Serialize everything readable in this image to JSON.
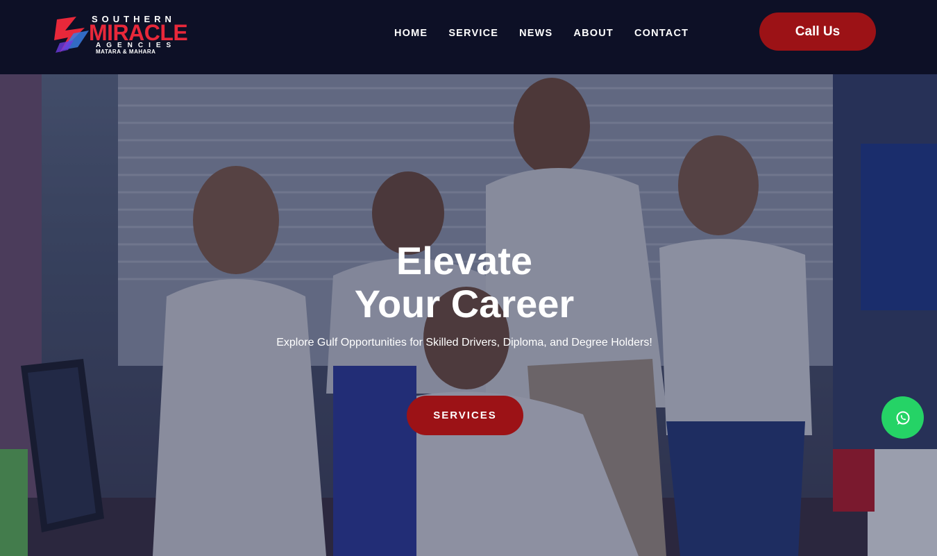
{
  "brand": {
    "line1": "SOUTHERN",
    "line2": "MIRACLE",
    "line3": "AGENCIES",
    "line4": "MATARA & MAHARA"
  },
  "nav": {
    "items": [
      "HOME",
      "SERVICE",
      "NEWS",
      "ABOUT",
      "CONTACT"
    ]
  },
  "header": {
    "call_label": "Call Us"
  },
  "hero": {
    "title_line1": "Elevate",
    "title_line2": "Your Career",
    "subtitle": "Explore Gulf Opportunities for Skilled Drivers, Diploma, and Degree Holders!",
    "cta_label": "SERVICES"
  },
  "floating": {
    "icon": "whatsapp-icon"
  },
  "colors": {
    "header_bg": "#0d1026",
    "accent": "#9c1216",
    "brand_red": "#e8283a",
    "whatsapp": "#25d366"
  }
}
